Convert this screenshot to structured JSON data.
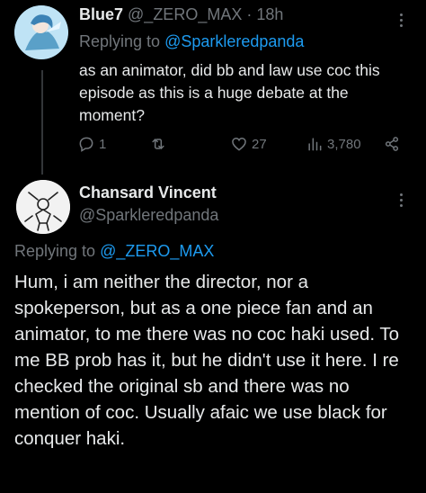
{
  "tweet1": {
    "display_name": "Blue7",
    "handle_time": " @_ZERO_MAX · 18h",
    "replying_prefix": "Replying to ",
    "replying_handle": "@Sparkleredpanda",
    "body": "as an animator, did bb and law use coc this episode as this is a huge debate at the moment?",
    "actions": {
      "replies": "1",
      "retweets": "",
      "likes": "27",
      "views": "3,780"
    }
  },
  "tweet2": {
    "display_name": "Chansard Vincent",
    "handle": "@Sparkleredpanda",
    "replying_prefix": "Replying to ",
    "replying_handle": "@_ZERO_MAX",
    "body": "Hum, i am neither the director, nor a spokeperson, but as a one piece fan and an animator, to me there was no coc haki used. To me BB prob has it, but he didn't use it here. I re checked the original sb and there was no mention of coc. Usually afaic we use black for conquer haki."
  },
  "colors": {
    "background": "#000000",
    "text": "#e7e9ea",
    "muted": "#71767b",
    "link": "#1d9bf0"
  },
  "icons": [
    "reply-icon",
    "retweet-icon",
    "like-icon",
    "views-icon",
    "share-icon",
    "more-icon"
  ]
}
